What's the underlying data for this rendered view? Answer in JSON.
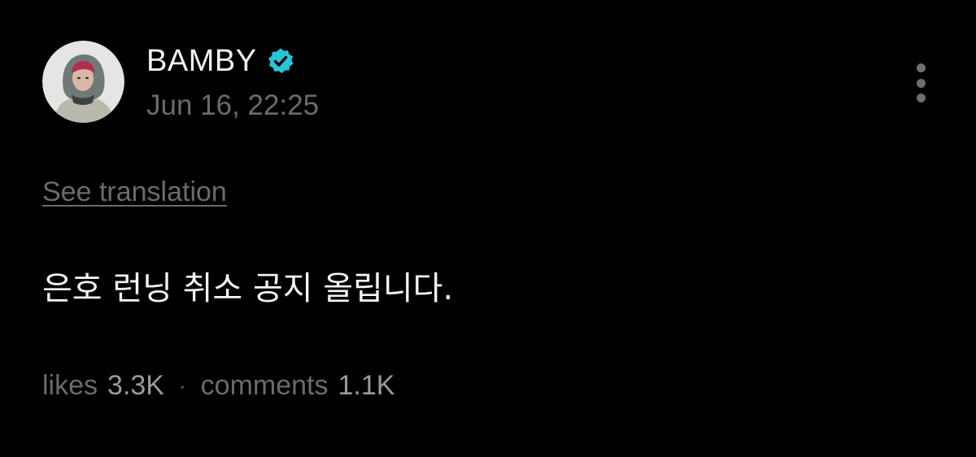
{
  "post": {
    "author": {
      "name": "BAMBY",
      "verified": true,
      "verified_icon": "verified-badge-icon",
      "avatar_icon": "avatar-hooded-figure"
    },
    "timestamp": "Jun 16, 22:25",
    "more_icon": "vertical-dots-icon",
    "see_translation_label": "See translation",
    "body": "은호 런닝 취소 공지 올립니다.",
    "stats": {
      "likes_label": "likes",
      "likes_value": "3.3K",
      "separator": "·",
      "comments_label": "comments",
      "comments_value": "1.1K"
    }
  },
  "colors": {
    "background": "#000000",
    "primary_text": "#f2f2f2",
    "secondary_text": "#6b6b6b",
    "verified_badge": "#29c4d8"
  }
}
